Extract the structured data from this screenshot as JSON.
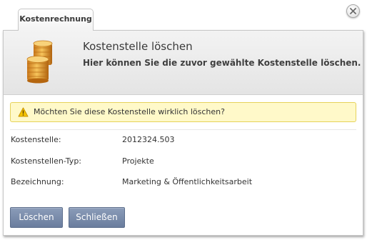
{
  "dialog": {
    "tab_label": "Kostenrechnung",
    "title": "Kostenstelle löschen",
    "subtitle": "Hier können Sie die zuvor gewählte Kostenstelle löschen.",
    "header_icon": "coin-stack-icon",
    "close_icon": "close-icon"
  },
  "warning": {
    "icon": "warning-icon",
    "text": "Möchten Sie diese Kostenstelle wirklich löschen?",
    "color": "#fff9c9"
  },
  "fields": [
    {
      "label": "Kostenstelle:",
      "value": "2012324.503"
    },
    {
      "label": "Kostenstellen-Typ:",
      "value": "Projekte"
    },
    {
      "label": "Bezeichnung:",
      "value": "Marketing & Öffentlichkeitsarbeit"
    }
  ],
  "buttons": {
    "delete_label": "Löschen",
    "close_label": "Schließen",
    "color": "#7a8cab"
  }
}
